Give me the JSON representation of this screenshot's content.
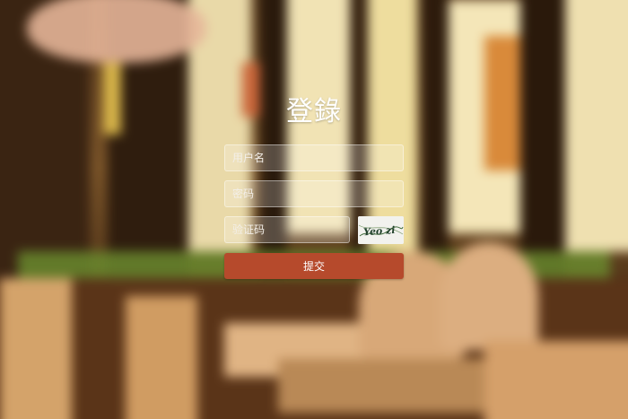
{
  "login": {
    "title": "登錄",
    "username_placeholder": "用户名",
    "password_placeholder": "密码",
    "captcha_placeholder": "验证码",
    "captcha_text": "Yeo zi",
    "submit_label": "提交"
  },
  "colors": {
    "submit_button": "#b64a2c",
    "title_text": "#ffffff"
  }
}
